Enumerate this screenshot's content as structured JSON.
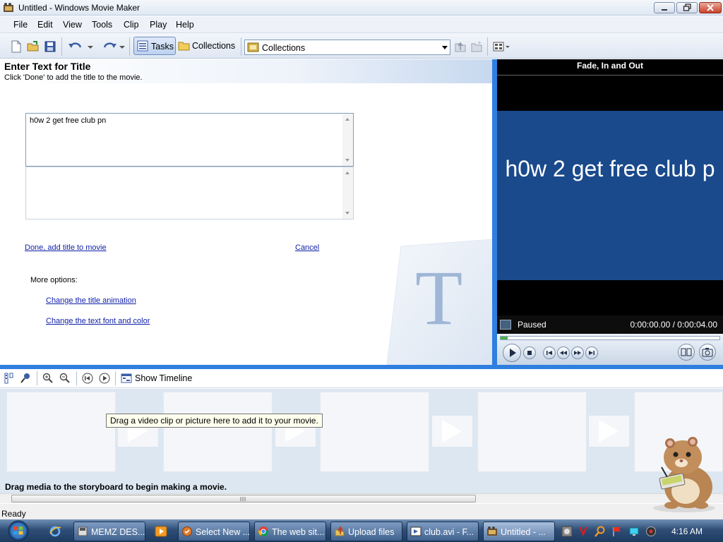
{
  "window": {
    "title": "Untitled - Windows Movie Maker"
  },
  "menu": [
    {
      "label": "File"
    },
    {
      "label": "Edit"
    },
    {
      "label": "View"
    },
    {
      "label": "Tools"
    },
    {
      "label": "Clip"
    },
    {
      "label": "Play"
    },
    {
      "label": "Help"
    }
  ],
  "toolbar": {
    "tasks_label": "Tasks",
    "collections_label": "Collections",
    "collection_select_value": "Collections"
  },
  "task_pane": {
    "title": "Enter Text for Title",
    "subtitle": "Click 'Done' to add the title to the movie.",
    "title_text_value": "h0w 2 get free club pn",
    "done_link": "Done, add title to movie",
    "cancel_link": "Cancel",
    "more_options_label": "More options:",
    "option_links": [
      "Change the title animation",
      "Change the text font and color"
    ]
  },
  "preview": {
    "title": "Fade, In and Out",
    "screen_text": "h0w 2 get free club p",
    "status": "Paused",
    "time": "0:00:00.00 / 0:00:04.00",
    "progress_fraction": 0.0
  },
  "storyboard": {
    "show_timeline_label": "Show Timeline",
    "tooltip": "Drag a video clip or picture here to add it to your movie.",
    "hint": "Drag media to the storyboard to begin making a movie."
  },
  "statusbar": {
    "text": "Ready"
  },
  "taskbar": {
    "tasks": [
      {
        "label": "MEMZ DES...",
        "icon": "disk-icon"
      },
      {
        "label": "Select New ...",
        "icon": "select-icon"
      },
      {
        "label": "The web sit...",
        "icon": "chrome-icon"
      },
      {
        "label": "Upload files",
        "icon": "upload-icon"
      },
      {
        "label": "club.avi - F...",
        "icon": "video-icon"
      },
      {
        "label": "Untitled - ...",
        "icon": "moviemaker-icon"
      }
    ],
    "clock": "4:16 AM"
  },
  "colors": {
    "accent_blue": "#2f7fe0",
    "preview_screen": "#1a4a8c",
    "link": "#0f1fa8"
  }
}
